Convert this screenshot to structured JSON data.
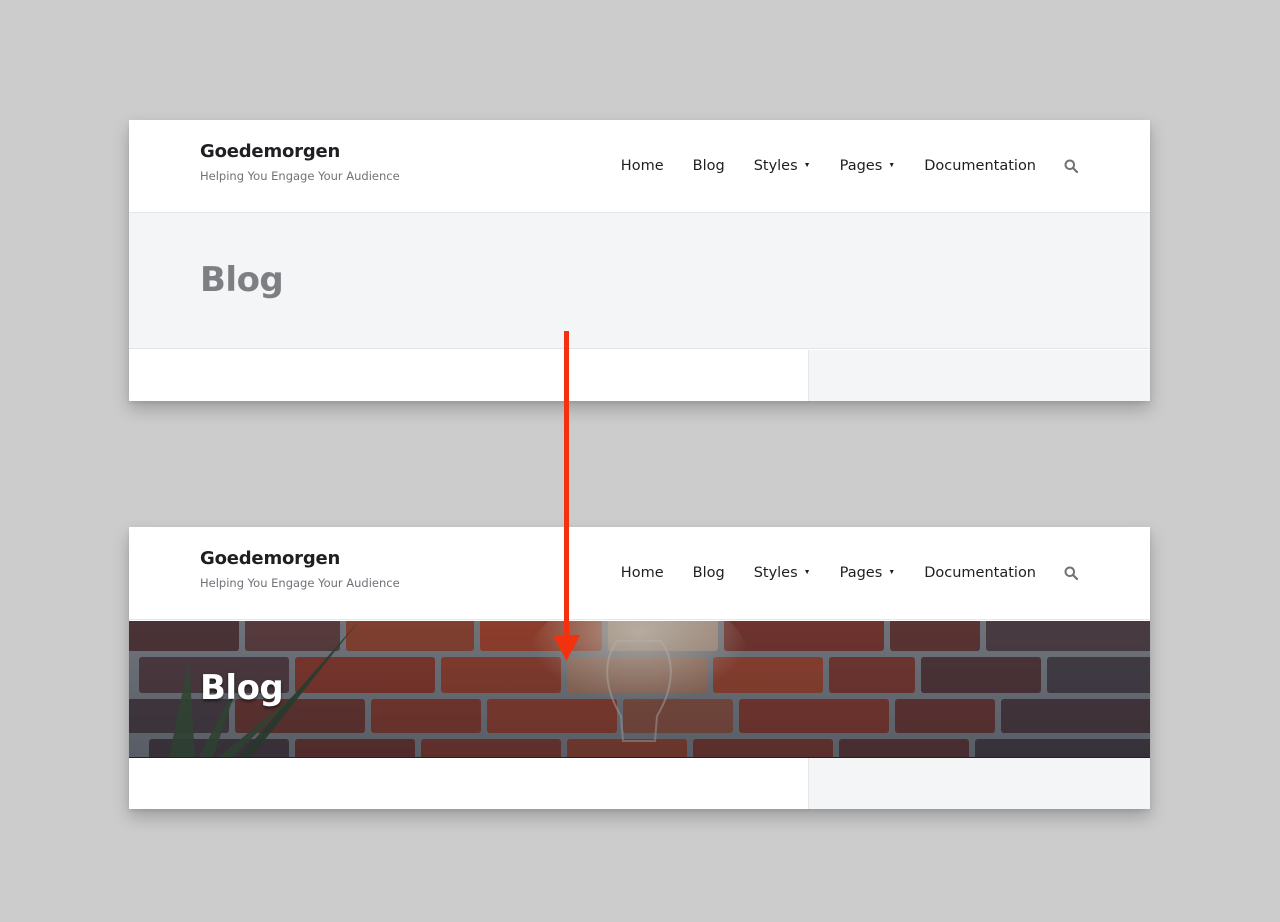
{
  "before": {
    "site_title": "Goedemorgen",
    "site_tagline": "Helping You Engage Your Audience",
    "nav": {
      "home": "Home",
      "blog": "Blog",
      "styles": "Styles",
      "pages": "Pages",
      "documentation": "Documentation"
    },
    "hero_title": "Blog",
    "hero_background": "#f4f5f7"
  },
  "after": {
    "site_title": "Goedemorgen",
    "site_tagline": "Helping You Engage Your Audience",
    "nav": {
      "home": "Home",
      "blog": "Blog",
      "styles": "Styles",
      "pages": "Pages",
      "documentation": "Documentation"
    },
    "hero_title": "Blog",
    "hero_background": "brick-wall-photo"
  },
  "icons": {
    "dropdown": "caret-down-icon",
    "search": "search-icon",
    "arrow": "arrow-down-icon"
  },
  "colors": {
    "canvas": "#cccccc",
    "arrow": "#f2320f",
    "title": "#1d1f23",
    "hero_muted": "#7d7f83",
    "sidebar": "#f4f5f7"
  }
}
